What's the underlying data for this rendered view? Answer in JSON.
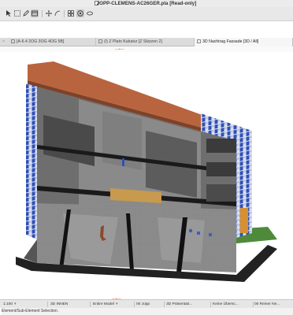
{
  "window": {
    "title": "JOPP-CLEMENS-AC26GER.pla [Read-only]"
  },
  "tabs": [
    {
      "label": "[A-6.4 2OG 3OG 4OG 5B]"
    },
    {
      "label": "(I) Z Plato Kubatur [Z Skizzen 2]"
    },
    {
      "label": "3D Nachtrag Fassade [3D / All]",
      "active": true
    }
  ],
  "statusbar": {
    "scale": "1:100",
    "view": "3D INNEN",
    "model": "Entire Model",
    "layer": "00 Jopp",
    "presentation": "3D Präsentati...",
    "override": "Keine Übersc...",
    "renovation": "00 Reiner Ne..."
  },
  "hint": "Element/Sub-Element Selection.",
  "colors": {
    "roof": "#b8653f",
    "glass_blue": "#2f4fb8",
    "grass": "#4f8a3b",
    "wood": "#c79a4e",
    "orange_panel": "#d8902e"
  }
}
